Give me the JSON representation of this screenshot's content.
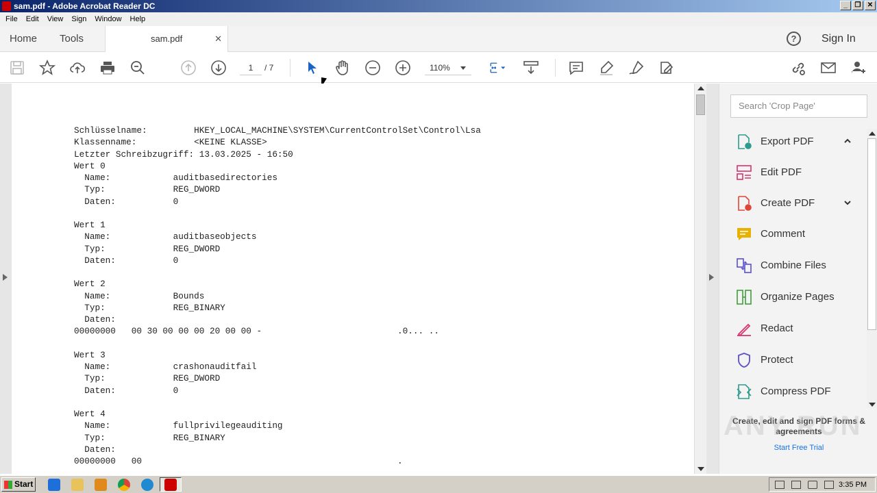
{
  "window": {
    "title": "sam.pdf - Adobe Acrobat Reader DC",
    "btn_min": "_",
    "btn_max": "❐",
    "btn_close": "✕"
  },
  "menu": [
    "File",
    "Edit",
    "View",
    "Sign",
    "Window",
    "Help"
  ],
  "tabs": {
    "home": "Home",
    "tools": "Tools",
    "doc": "sam.pdf",
    "close": "✕"
  },
  "header": {
    "help": "?",
    "sign_in": "Sign In"
  },
  "toolbar": {
    "page_current": "1",
    "page_total": "/ 7",
    "zoom": "110%"
  },
  "document": {
    "text": "Schlüsselname:         HKEY_LOCAL_MACHINE\\SYSTEM\\CurrentControlSet\\Control\\Lsa\nKlassenname:           <KEINE KLASSE>\nLetzter Schreibzugriff: 13.03.2025 - 16:50\nWert 0\n  Name:            auditbasedirectories\n  Typ:             REG_DWORD\n  Daten:           0\n\nWert 1\n  Name:            auditbaseobjects\n  Typ:             REG_DWORD\n  Daten:           0\n\nWert 2\n  Name:            Bounds\n  Typ:             REG_BINARY\n  Daten:\n00000000   00 30 00 00 00 20 00 00 -                          .0... ..\n\nWert 3\n  Name:            crashonauditfail\n  Typ:             REG_DWORD\n  Daten:           0\n\nWert 4\n  Name:            fullprivilegeauditing\n  Typ:             REG_BINARY\n  Daten:\n00000000   00                                                 ."
  },
  "right_panel": {
    "search_placeholder": "Search 'Crop Page'",
    "tools": [
      {
        "label": "Export PDF",
        "color": "#2d9c8f",
        "icon": "export-pdf-icon"
      },
      {
        "label": "Edit PDF",
        "color": "#d8336e",
        "icon": "edit-pdf-icon"
      },
      {
        "label": "Create PDF",
        "color": "#e0453a",
        "icon": "create-pdf-icon"
      },
      {
        "label": "Comment",
        "color": "#e8b100",
        "icon": "comment-icon"
      },
      {
        "label": "Combine Files",
        "color": "#5a4fcf",
        "icon": "combine-files-icon"
      },
      {
        "label": "Organize Pages",
        "color": "#3f9e3a",
        "icon": "organize-pages-icon"
      },
      {
        "label": "Redact",
        "color": "#d8336e",
        "icon": "redact-icon"
      },
      {
        "label": "Protect",
        "color": "#5a4fcf",
        "icon": "protect-icon"
      },
      {
        "label": "Compress PDF",
        "color": "#2d9c8f",
        "icon": "compress-pdf-icon"
      }
    ],
    "promo_text": "Create, edit and sign PDF forms & agreements",
    "promo_link": "Start Free Trial",
    "watermark": "ANY RUN"
  },
  "taskbar": {
    "start": "Start",
    "clock": "3:35 PM"
  }
}
